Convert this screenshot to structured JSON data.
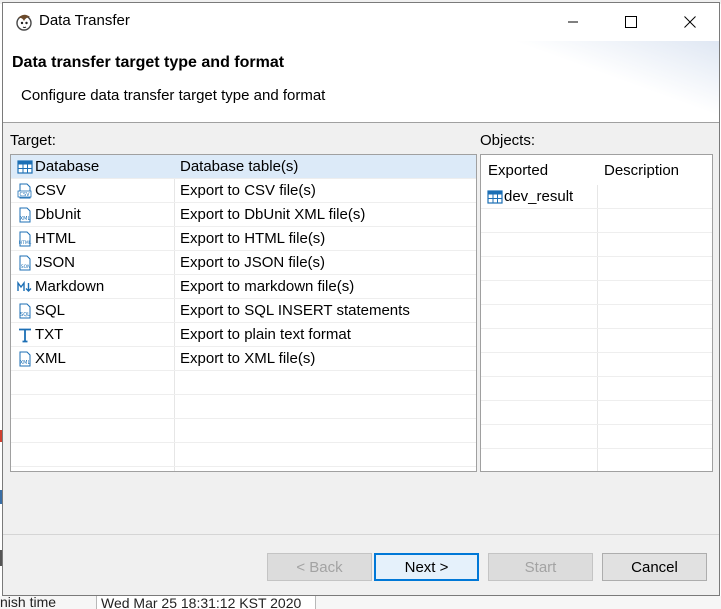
{
  "window": {
    "title": "Data Transfer"
  },
  "banner": {
    "title": "Data transfer target type and format",
    "description": "Configure data transfer target type and format"
  },
  "target": {
    "label": "Target:",
    "selected_index": 0,
    "items": [
      {
        "name": "Database",
        "description": "Database table(s)",
        "icon": "database-table-icon"
      },
      {
        "name": "CSV",
        "description": "Export to CSV file(s)",
        "icon": "csv-file-icon"
      },
      {
        "name": "DbUnit",
        "description": "Export to DbUnit XML file(s)",
        "icon": "xml-file-icon"
      },
      {
        "name": "HTML",
        "description": "Export to HTML file(s)",
        "icon": "html-file-icon"
      },
      {
        "name": "JSON",
        "description": "Export to JSON file(s)",
        "icon": "json-file-icon"
      },
      {
        "name": "Markdown",
        "description": "Export to markdown file(s)",
        "icon": "markdown-icon"
      },
      {
        "name": "SQL",
        "description": "Export to SQL INSERT statements",
        "icon": "sql-file-icon"
      },
      {
        "name": "TXT",
        "description": "Export to plain text format",
        "icon": "text-format-icon"
      },
      {
        "name": "XML",
        "description": "Export to XML file(s)",
        "icon": "xml-file-icon"
      }
    ]
  },
  "objects": {
    "label": "Objects:",
    "columns": [
      "Exported",
      "Description"
    ],
    "rows": [
      {
        "exported": "dev_result",
        "description": "",
        "icon": "database-table-icon"
      }
    ]
  },
  "buttons": {
    "back": "< Back",
    "next": "Next >",
    "start": "Start",
    "cancel": "Cancel"
  },
  "background": {
    "field_label": "nish time",
    "field_value": "Wed Mar 25 18:31:12 KST 2020"
  },
  "colors": {
    "selection": "#dceaf8",
    "accent": "#0078d7",
    "icon_blue": "#1c6fb5"
  }
}
